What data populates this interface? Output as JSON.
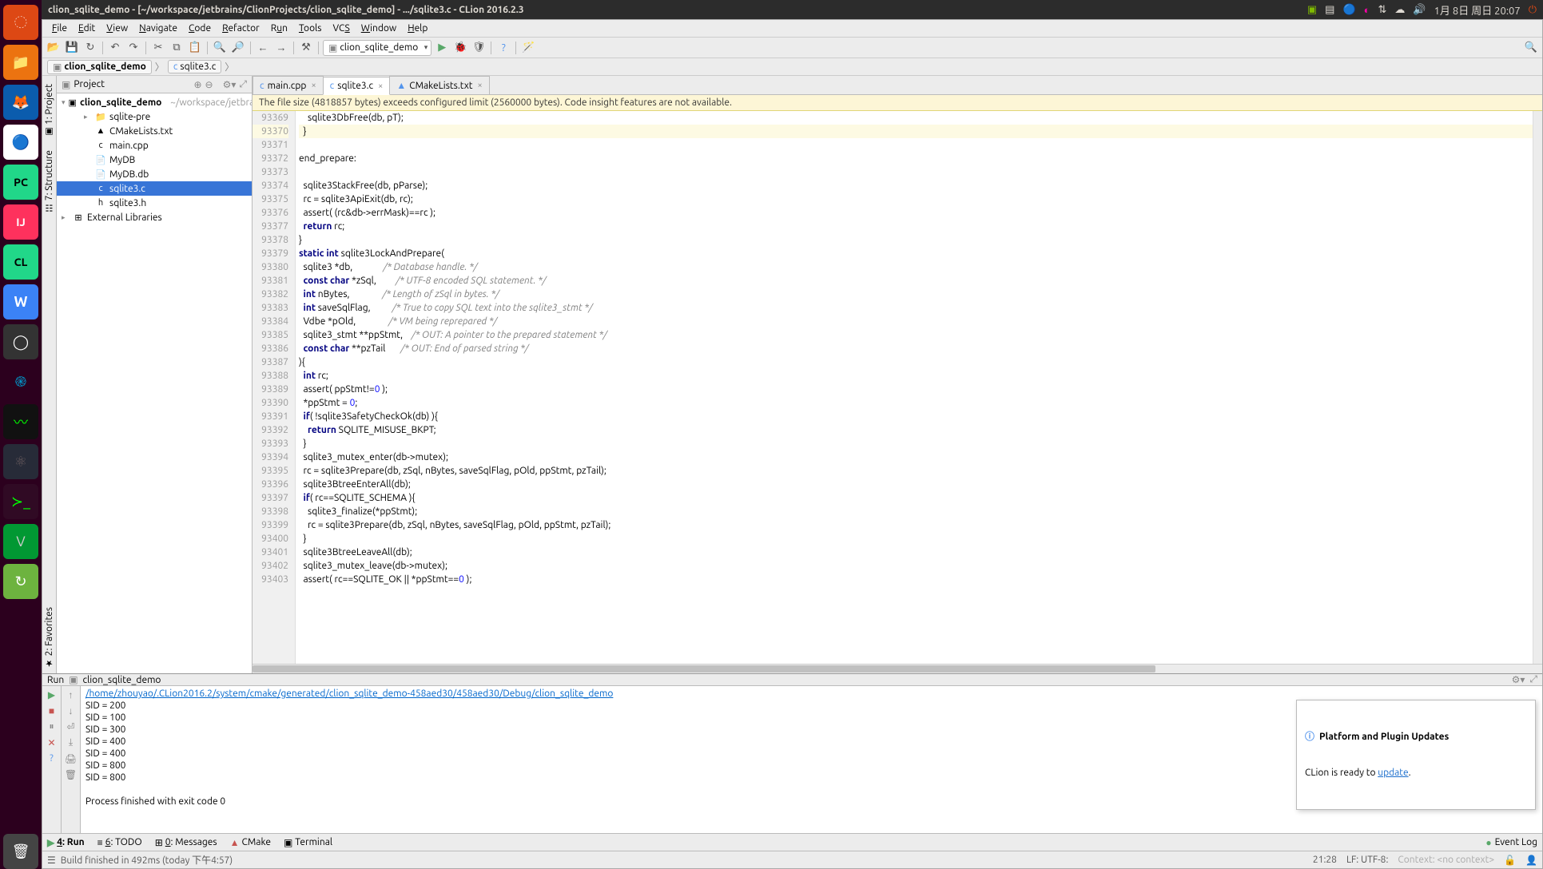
{
  "top_panel": {
    "title": "clion_sqlite_demo - [~/workspace/jetbrains/ClionProjects/clion_sqlite_demo] - .../sqlite3.c - CLion 2016.2.3",
    "datetime": "1月 8日 周日 20:07"
  },
  "menubar": [
    "File",
    "Edit",
    "View",
    "Navigate",
    "Code",
    "Refactor",
    "Run",
    "Tools",
    "VCS",
    "Window",
    "Help"
  ],
  "toolbar": {
    "run_config": "clion_sqlite_demo"
  },
  "breadcrumbs": {
    "root": "clion_sqlite_demo",
    "file": "sqlite3.c"
  },
  "project_panel": {
    "title": "Project",
    "root_name": "clion_sqlite_demo",
    "root_path": "~/workspace/jetbrains/ClionProjects/clion_sqlite_demo",
    "items": [
      {
        "name": "sqlite-pre",
        "icon": "📁",
        "indent": 2,
        "arrow": "▸"
      },
      {
        "name": "CMakeLists.txt",
        "icon": "▲",
        "indent": 2,
        "arrow": ""
      },
      {
        "name": "main.cpp",
        "icon": "c",
        "indent": 2,
        "arrow": ""
      },
      {
        "name": "MyDB",
        "icon": "📄",
        "indent": 2,
        "arrow": ""
      },
      {
        "name": "MyDB.db",
        "icon": "📄",
        "indent": 2,
        "arrow": ""
      },
      {
        "name": "sqlite3.c",
        "icon": "c",
        "indent": 2,
        "arrow": "",
        "selected": true
      },
      {
        "name": "sqlite3.h",
        "icon": "h",
        "indent": 2,
        "arrow": ""
      }
    ],
    "external": "External Libraries"
  },
  "editor_tabs": [
    {
      "label": "main.cpp",
      "icon": "c",
      "active": false
    },
    {
      "label": "sqlite3.c",
      "icon": "c",
      "active": true
    },
    {
      "label": "CMakeLists.txt",
      "icon": "▲",
      "active": false
    }
  ],
  "warning": "The file size (4818857 bytes) exceeds configured limit (2560000 bytes). Code insight features are not available.",
  "gutter_start": 93369,
  "gutter_end": 93403,
  "code_lines": [
    {
      "t": "    sqlite3DbFree(db, pT);"
    },
    {
      "t": "  }",
      "cur": true
    },
    {
      "t": ""
    },
    {
      "t": "end_prepare:"
    },
    {
      "t": ""
    },
    {
      "t": "  sqlite3StackFree(db, pParse);"
    },
    {
      "t": "  rc = sqlite3ApiExit(db, rc);"
    },
    {
      "t": "  assert( (rc&db->errMask)==rc );"
    },
    {
      "html": "  <span class='kw'>return</span> rc;"
    },
    {
      "t": "}"
    },
    {
      "html": "<span class='kw'>static</span> <span class='kw'>int</span> sqlite3LockAndPrepare("
    },
    {
      "html": "  sqlite3 *db,              <span class='cm'>/* Database handle. */</span>"
    },
    {
      "html": "  <span class='kw'>const</span> <span class='kw'>char</span> *zSql,         <span class='cm'>/* UTF-8 encoded SQL statement. */</span>"
    },
    {
      "html": "  <span class='kw'>int</span> nBytes,               <span class='cm'>/* Length of zSql in bytes. */</span>"
    },
    {
      "html": "  <span class='kw'>int</span> saveSqlFlag,          <span class='cm'>/* True to copy SQL text into the sqlite3_stmt */</span>"
    },
    {
      "html": "  Vdbe *pOld,               <span class='cm'>/* VM being reprepared */</span>"
    },
    {
      "html": "  sqlite3_stmt **ppStmt,    <span class='cm'>/* OUT: A pointer to the prepared statement */</span>"
    },
    {
      "html": "  <span class='kw'>const</span> <span class='kw'>char</span> **pzTail       <span class='cm'>/* OUT: End of parsed string */</span>"
    },
    {
      "t": "){"
    },
    {
      "html": "  <span class='kw'>int</span> rc;"
    },
    {
      "html": "  assert( ppStmt!=<span class='num'>0</span> );"
    },
    {
      "html": "  *ppStmt = <span class='num'>0</span>;"
    },
    {
      "html": "  <span class='kw'>if</span>( !sqlite3SafetyCheckOk(db) ){"
    },
    {
      "html": "    <span class='kw'>return</span> SQLITE_MISUSE_BKPT;"
    },
    {
      "t": "  }"
    },
    {
      "t": "  sqlite3_mutex_enter(db->mutex);"
    },
    {
      "t": "  rc = sqlite3Prepare(db, zSql, nBytes, saveSqlFlag, pOld, ppStmt, pzTail);"
    },
    {
      "t": "  sqlite3BtreeEnterAll(db);"
    },
    {
      "html": "  <span class='kw'>if</span>( rc==SQLITE_SCHEMA ){"
    },
    {
      "t": "    sqlite3_finalize(*ppStmt);"
    },
    {
      "t": "    rc = sqlite3Prepare(db, zSql, nBytes, saveSqlFlag, pOld, ppStmt, pzTail);"
    },
    {
      "t": "  }"
    },
    {
      "t": "  sqlite3BtreeLeaveAll(db);"
    },
    {
      "t": "  sqlite3_mutex_leave(db->mutex);"
    },
    {
      "html": "  assert( rc==SQLITE_OK || *ppStmt==<span class='num'>0</span> );"
    }
  ],
  "run": {
    "label": "Run",
    "config": "clion_sqlite_demo",
    "path": "/home/zhouyao/.CLion2016.2/system/cmake/generated/clion_sqlite_demo-458aed30/458aed30/Debug/clion_sqlite_demo",
    "output": [
      "SID = 200",
      "SID = 100",
      "SID = 300",
      "SID = 400",
      "SID = 400",
      "SID = 800",
      "SID = 800",
      "",
      "Process finished with exit code 0"
    ]
  },
  "notif": {
    "title": "Platform and Plugin Updates",
    "body_pre": "CLion is ready to ",
    "link": "update",
    "body_post": "."
  },
  "bottom_tabs": {
    "run": "4: Run",
    "todo": "6: TODO",
    "messages": "0: Messages",
    "cmake": "CMake",
    "terminal": "Terminal",
    "eventlog": "Event Log"
  },
  "statusbar": {
    "msg": "Build finished in 492ms (today 下午4:57)",
    "pos": "21:28",
    "enc": "LF:  UTF-8:",
    "ctx": "Context: <no context>"
  },
  "left_vtabs": {
    "project": "1: Project",
    "structure": "7: Structure",
    "favorites": "2: Favorites"
  }
}
